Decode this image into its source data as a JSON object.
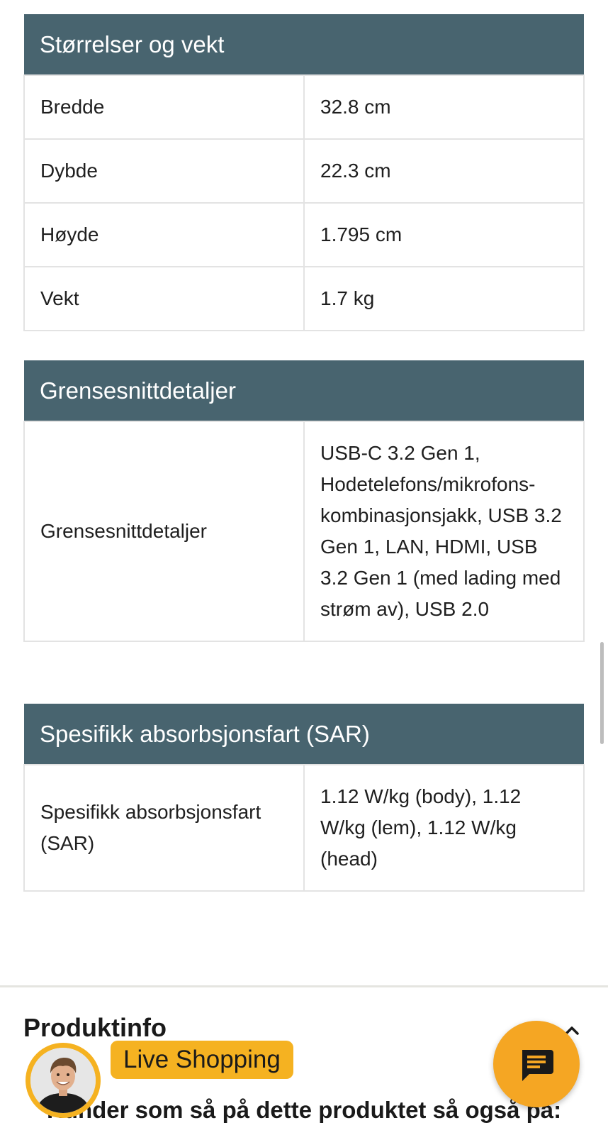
{
  "sizes": {
    "heading": "Størrelser og vekt",
    "rows": [
      {
        "label": "Bredde",
        "value": "32.8 cm"
      },
      {
        "label": "Dybde",
        "value": "22.3 cm"
      },
      {
        "label": "Høyde",
        "value": "1.795 cm"
      },
      {
        "label": "Vekt",
        "value": "1.7 kg"
      }
    ]
  },
  "interface": {
    "heading": "Grensesnittdetaljer",
    "rows": [
      {
        "label": "Grensesnittdetaljer",
        "value": "USB-C 3.2 Gen 1, Hodetelefons/mikrofons-kombinasjonsjakk, USB 3.2 Gen 1, LAN, HDMI, USB 3.2 Gen 1 (med lading med strøm av), USB 2.0"
      }
    ]
  },
  "sar": {
    "heading": "Spesifikk absorbsjonsfart (SAR)",
    "rows": [
      {
        "label": "Spesifikk absorbsjonsfart (SAR)",
        "value": "1.12 W/kg (body), 1.12 W/kg (lem), 1.12 W/kg (head)"
      }
    ]
  },
  "produktinfo": {
    "title": "Produktinfo",
    "toggle_icon": "chevron-up-icon"
  },
  "customers_also_viewed": {
    "title": "Kunder som så på dette produktet så også på:"
  },
  "live_shopping": {
    "label": "Live Shopping",
    "avatar_icon": "person-avatar",
    "accent": "#f5b221"
  },
  "chat": {
    "icon": "chat-bubble-icon",
    "color": "#f5a623"
  },
  "colors": {
    "table_header": "#48646f",
    "table_border": "#e3e3e3"
  }
}
